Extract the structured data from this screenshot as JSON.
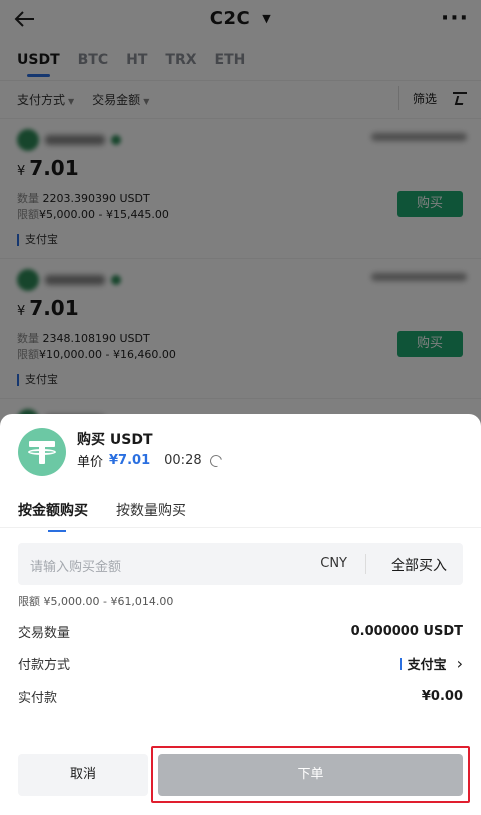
{
  "header": {
    "title": "C2C",
    "back_icon": "back-arrow-icon",
    "more_icon": "more-icon"
  },
  "coins": [
    "USDT",
    "BTC",
    "HT",
    "TRX",
    "ETH"
  ],
  "filters": {
    "payment": "支付方式",
    "amount": "交易金额",
    "screen": "筛选"
  },
  "ads": [
    {
      "currency_symbol": "¥",
      "price": "7.01",
      "qty_label": "数量",
      "qty": "2203.390390 USDT",
      "limit_label": "限额",
      "limit": "¥5,000.00 - ¥15,445.00",
      "buy": "购买",
      "pay": "支付宝"
    },
    {
      "currency_symbol": "¥",
      "price": "7.01",
      "qty_label": "数量",
      "qty": "2348.108190 USDT",
      "limit_label": "限额",
      "limit": "¥10,000.00 - ¥16,460.00",
      "buy": "购买",
      "pay": "支付宝"
    }
  ],
  "sheet": {
    "title": "购买 USDT",
    "unit_label": "单价",
    "unit_price": "¥7.01",
    "timer": "00:28",
    "tabs": [
      "按金额购买",
      "按数量购买"
    ],
    "input_placeholder": "请输入购买金额",
    "currency": "CNY",
    "buy_all": "全部买入",
    "limit": "限额 ¥5,000.00 - ¥61,014.00",
    "rows": [
      {
        "label": "交易数量",
        "value": "0.000000 USDT"
      },
      {
        "label": "付款方式",
        "value": "支付宝"
      },
      {
        "label": "实付款",
        "value": "¥0.00"
      }
    ],
    "cancel": "取消",
    "submit": "下单"
  },
  "colors": {
    "accent": "#2a6fe0",
    "buy_green": "#1ea971",
    "highlight": "#e01e2e"
  }
}
